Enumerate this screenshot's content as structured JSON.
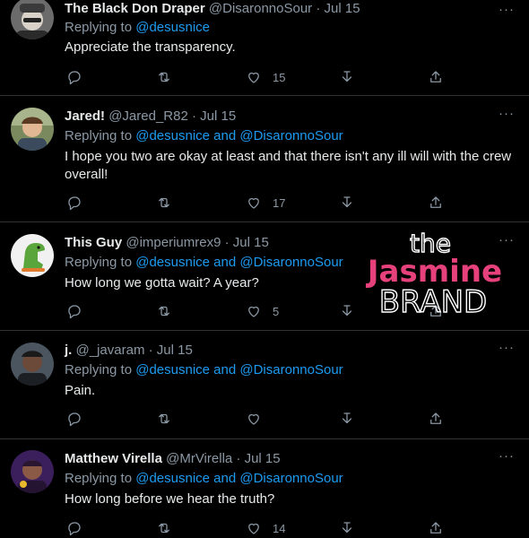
{
  "tweets": [
    {
      "name": "The Black Don Draper",
      "handle": "@DisaronnoSour",
      "time": "Jul 15",
      "replying_label": "Replying to",
      "replying_to": "@desusnice",
      "replying_and": "",
      "replying_to2": "",
      "text": "Appreciate the transparency.",
      "likes": "15",
      "avatar": "person-gray-hat-icon"
    },
    {
      "name": "Jared!",
      "handle": "@Jared_R82",
      "time": "Jul 15",
      "replying_label": "Replying to",
      "replying_to": "@desusnice",
      "replying_and": "and",
      "replying_to2": "@DisaronnoSour",
      "text": "I hope you two are okay at least and that there isn't any ill will with the crew overall!",
      "likes": "17",
      "avatar": "person-photo-icon"
    },
    {
      "name": "This Guy",
      "handle": "@imperiumrex9",
      "time": "Jul 15",
      "replying_label": "Replying to",
      "replying_to": "@desusnice",
      "replying_and": "and",
      "replying_to2": "@DisaronnoSour",
      "text": "How long we gotta wait? A year?",
      "likes": "5",
      "avatar": "dinosaur-icon"
    },
    {
      "name": "j.",
      "handle": "@_javaram",
      "time": "Jul 15",
      "replying_label": "Replying to",
      "replying_to": "@desusnice",
      "replying_and": "and",
      "replying_to2": "@DisaronnoSour",
      "text": "Pain.",
      "likes": "",
      "avatar": "person-dark-icon"
    },
    {
      "name": "Matthew Virella",
      "handle": "@MrVirella",
      "time": "Jul 15",
      "replying_label": "Replying to",
      "replying_to": "@desusnice",
      "replying_and": "and",
      "replying_to2": "@DisaronnoSour",
      "text": "How long before we hear the truth?",
      "likes": "14",
      "avatar": "person-purple-icon"
    }
  ],
  "ui": {
    "separator": "·",
    "more_glyph": "···"
  },
  "watermark": {
    "line1": "the",
    "line2": "Jasmine",
    "line3": "BRAND"
  },
  "colors": {
    "background": "#000000",
    "text": "#e7e9ea",
    "secondary": "#8b98a5",
    "link": "#1d9bf0",
    "divider": "#2f3336",
    "watermark_pink": "#e7417c"
  }
}
